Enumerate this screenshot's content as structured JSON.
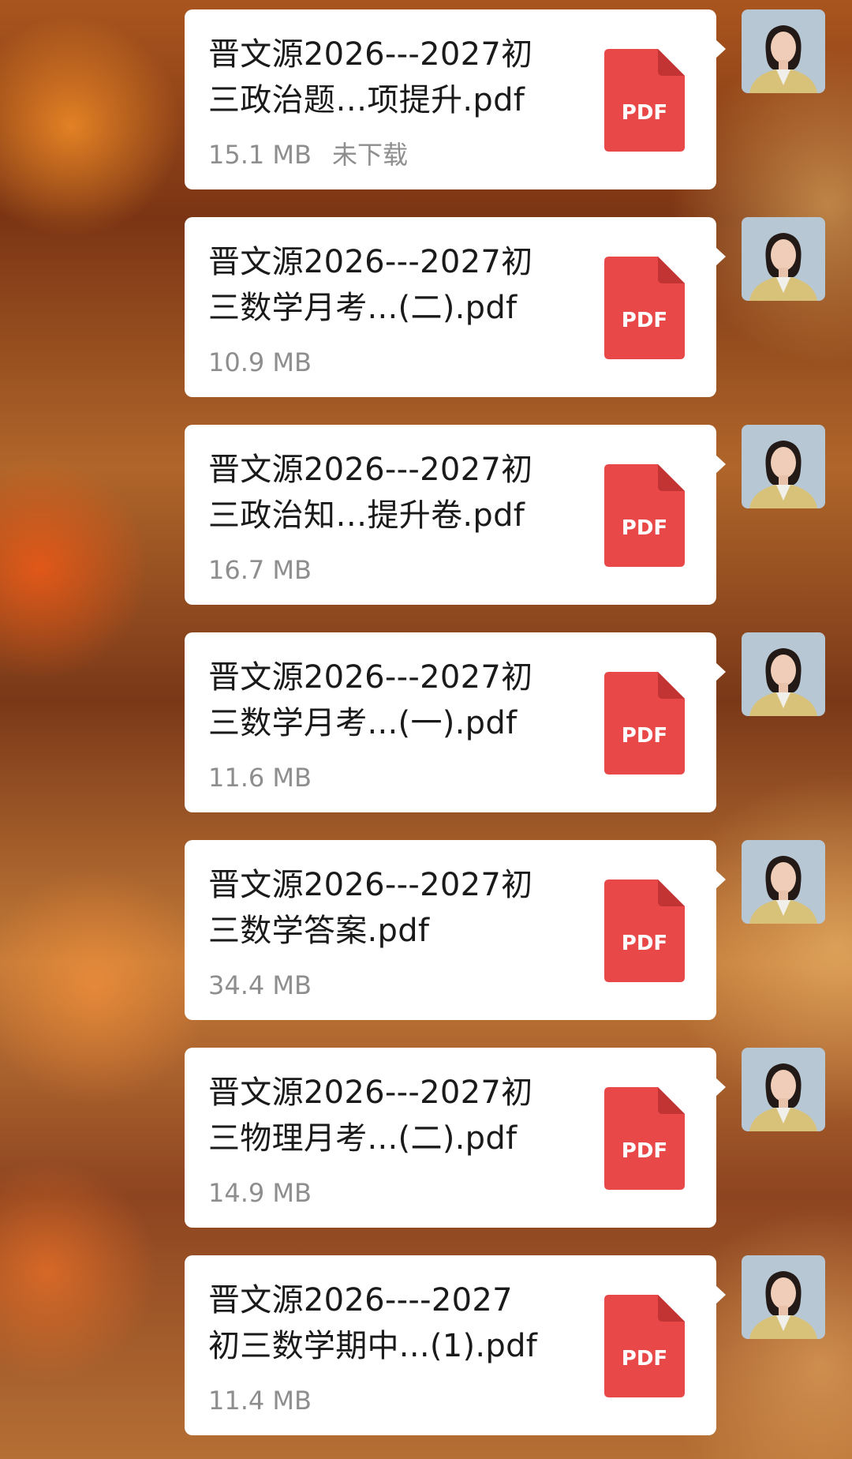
{
  "colors": {
    "bubble": "#ffffff",
    "pdf_red": "#e84848",
    "pdf_fold": "#c23434",
    "filename_text": "#1a1a1a",
    "meta_text": "#8e8e8e"
  },
  "messages": [
    {
      "file_name": "晋文源2026---2027初\n三政治题…项提升.pdf",
      "size": "15.1 MB",
      "status": "未下载",
      "icon_label": "PDF",
      "icon": "pdf-file-icon"
    },
    {
      "file_name": "晋文源2026---2027初\n三数学月考...(二).pdf",
      "size": "10.9 MB",
      "status": "",
      "icon_label": "PDF",
      "icon": "pdf-file-icon"
    },
    {
      "file_name": "晋文源2026---2027初\n三政治知…提升卷.pdf",
      "size": "16.7 MB",
      "status": "",
      "icon_label": "PDF",
      "icon": "pdf-file-icon"
    },
    {
      "file_name": "晋文源2026---2027初\n三数学月考...(一).pdf",
      "size": "11.6 MB",
      "status": "",
      "icon_label": "PDF",
      "icon": "pdf-file-icon"
    },
    {
      "file_name": "晋文源2026---2027初\n三数学答案.pdf",
      "size": "34.4 MB",
      "status": "",
      "icon_label": "PDF",
      "icon": "pdf-file-icon"
    },
    {
      "file_name": "晋文源2026---2027初\n三物理月考...(二).pdf",
      "size": "14.9 MB",
      "status": "",
      "icon_label": "PDF",
      "icon": "pdf-file-icon"
    },
    {
      "file_name": "晋文源2026----2027\n初三数学期中...(1).pdf",
      "size": "11.4 MB",
      "status": "",
      "icon_label": "PDF",
      "icon": "pdf-file-icon"
    }
  ]
}
